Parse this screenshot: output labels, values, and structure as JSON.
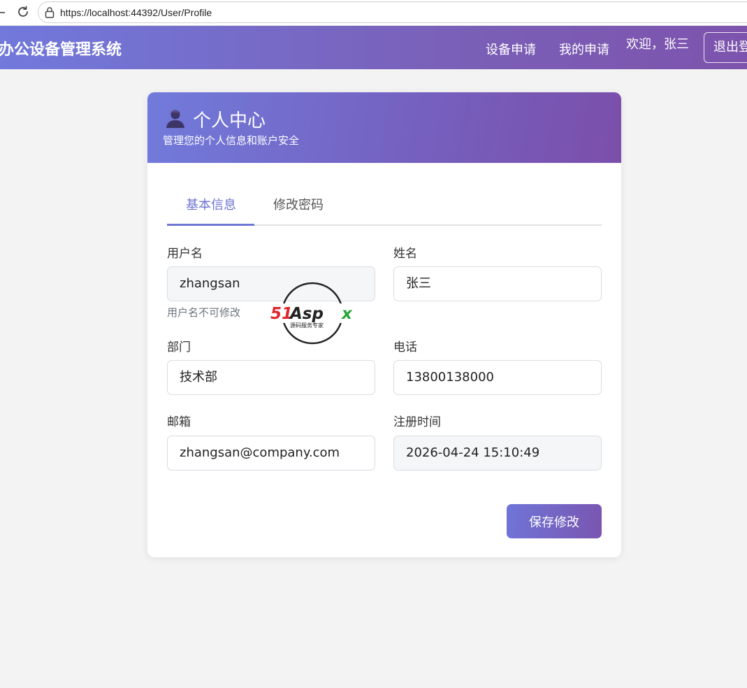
{
  "browser": {
    "url": "https://localhost:44392/User/Profile"
  },
  "navbar": {
    "brand": "办公设备管理系统",
    "links": [
      "设备申请",
      "我的申请"
    ],
    "welcome": "欢迎，张三",
    "logout_label": "退出登录"
  },
  "card": {
    "title": "个人中心",
    "subtitle": "管理您的个人信息和账户安全",
    "tabs": [
      {
        "label": "基本信息",
        "active": true
      },
      {
        "label": "修改密码",
        "active": false
      }
    ],
    "form": {
      "username": {
        "label": "用户名",
        "value": "zhangsan",
        "hint": "用户名不可修改",
        "readonly": true
      },
      "name": {
        "label": "姓名",
        "value": "张三"
      },
      "department": {
        "label": "部门",
        "value": "技术部"
      },
      "phone": {
        "label": "电话",
        "value": "13800138000"
      },
      "email": {
        "label": "邮箱",
        "value": "zhangsan@company.com"
      },
      "register_time": {
        "label": "注册时间",
        "value": "2026-04-24 15:10:49",
        "readonly": true
      }
    },
    "save_label": "保存修改"
  },
  "watermark": {
    "brand": "51Aspx",
    "tagline": "源码服务专家"
  },
  "colors": {
    "accent": "#6e77d6",
    "header_start": "#7179db",
    "header_end": "#7b4faa"
  }
}
